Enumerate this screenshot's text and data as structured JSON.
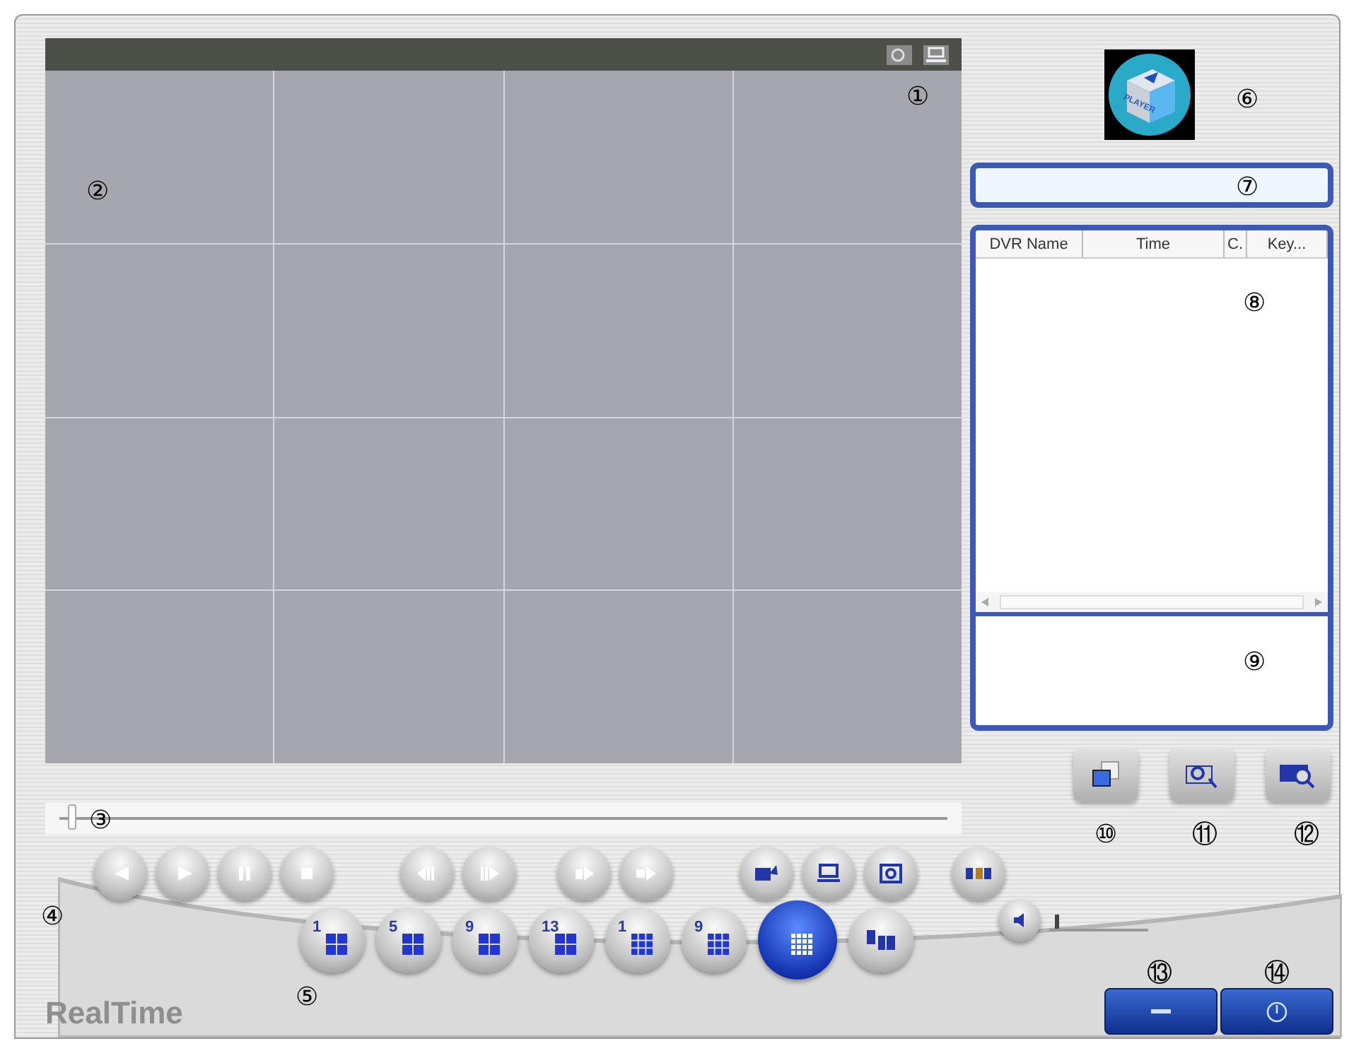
{
  "logo": {
    "text": "PLAYER"
  },
  "table": {
    "columns": [
      "DVR Name",
      "Time",
      "C.",
      "Key..."
    ]
  },
  "seek": {
    "level": 0.01
  },
  "playback_groups": [
    [
      {
        "kind": "prev"
      },
      {
        "kind": "play"
      },
      {
        "kind": "pause"
      },
      {
        "kind": "stop"
      }
    ],
    [
      {
        "kind": "step-back"
      },
      {
        "kind": "step-forward"
      }
    ],
    [
      {
        "kind": "slow"
      },
      {
        "kind": "fast"
      }
    ],
    [
      {
        "kind": "record"
      },
      {
        "kind": "monitor"
      },
      {
        "kind": "camera"
      }
    ],
    [
      {
        "kind": "film"
      }
    ]
  ],
  "split_buttons": [
    {
      "kind": "quad",
      "label": "1",
      "selected": false
    },
    {
      "kind": "quad",
      "label": "5",
      "selected": false
    },
    {
      "kind": "quad",
      "label": "9",
      "selected": false
    },
    {
      "kind": "quad",
      "label": "13",
      "selected": false
    },
    {
      "kind": "nine",
      "label": "1",
      "selected": false
    },
    {
      "kind": "nine",
      "label": "9",
      "selected": false
    },
    {
      "kind": "sixteen",
      "selected": true
    },
    {
      "kind": "cycle",
      "selected": false
    }
  ],
  "volume": {
    "level": 0.05
  },
  "brand": "RealTime",
  "callouts": [
    "①",
    "②",
    "③",
    "④",
    "⑤",
    "⑥",
    "⑦",
    "⑧",
    "⑨",
    "⑩",
    "⑪",
    "⑫",
    "⑬",
    "⑭"
  ]
}
